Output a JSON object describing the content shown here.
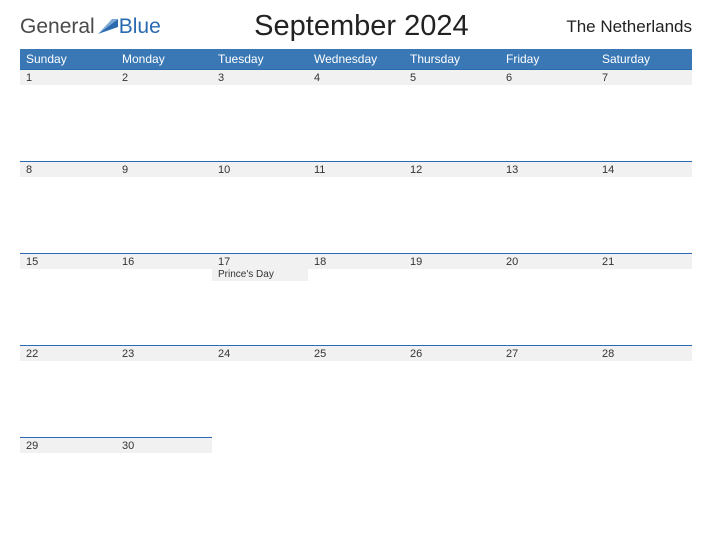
{
  "logo": {
    "text1": "General",
    "text2": "Blue"
  },
  "title": "September 2024",
  "region": "The Netherlands",
  "weekdays": [
    "Sunday",
    "Monday",
    "Tuesday",
    "Wednesday",
    "Thursday",
    "Friday",
    "Saturday"
  ],
  "weeks": [
    [
      {
        "n": "1"
      },
      {
        "n": "2"
      },
      {
        "n": "3"
      },
      {
        "n": "4"
      },
      {
        "n": "5"
      },
      {
        "n": "6"
      },
      {
        "n": "7"
      }
    ],
    [
      {
        "n": "8"
      },
      {
        "n": "9"
      },
      {
        "n": "10"
      },
      {
        "n": "11"
      },
      {
        "n": "12"
      },
      {
        "n": "13"
      },
      {
        "n": "14"
      }
    ],
    [
      {
        "n": "15"
      },
      {
        "n": "16"
      },
      {
        "n": "17",
        "event": "Prince's Day"
      },
      {
        "n": "18"
      },
      {
        "n": "19"
      },
      {
        "n": "20"
      },
      {
        "n": "21"
      }
    ],
    [
      {
        "n": "22"
      },
      {
        "n": "23"
      },
      {
        "n": "24"
      },
      {
        "n": "25"
      },
      {
        "n": "26"
      },
      {
        "n": "27"
      },
      {
        "n": "28"
      }
    ],
    [
      {
        "n": "29"
      },
      {
        "n": "30"
      },
      {
        "n": ""
      },
      {
        "n": ""
      },
      {
        "n": ""
      },
      {
        "n": ""
      },
      {
        "n": ""
      }
    ]
  ]
}
